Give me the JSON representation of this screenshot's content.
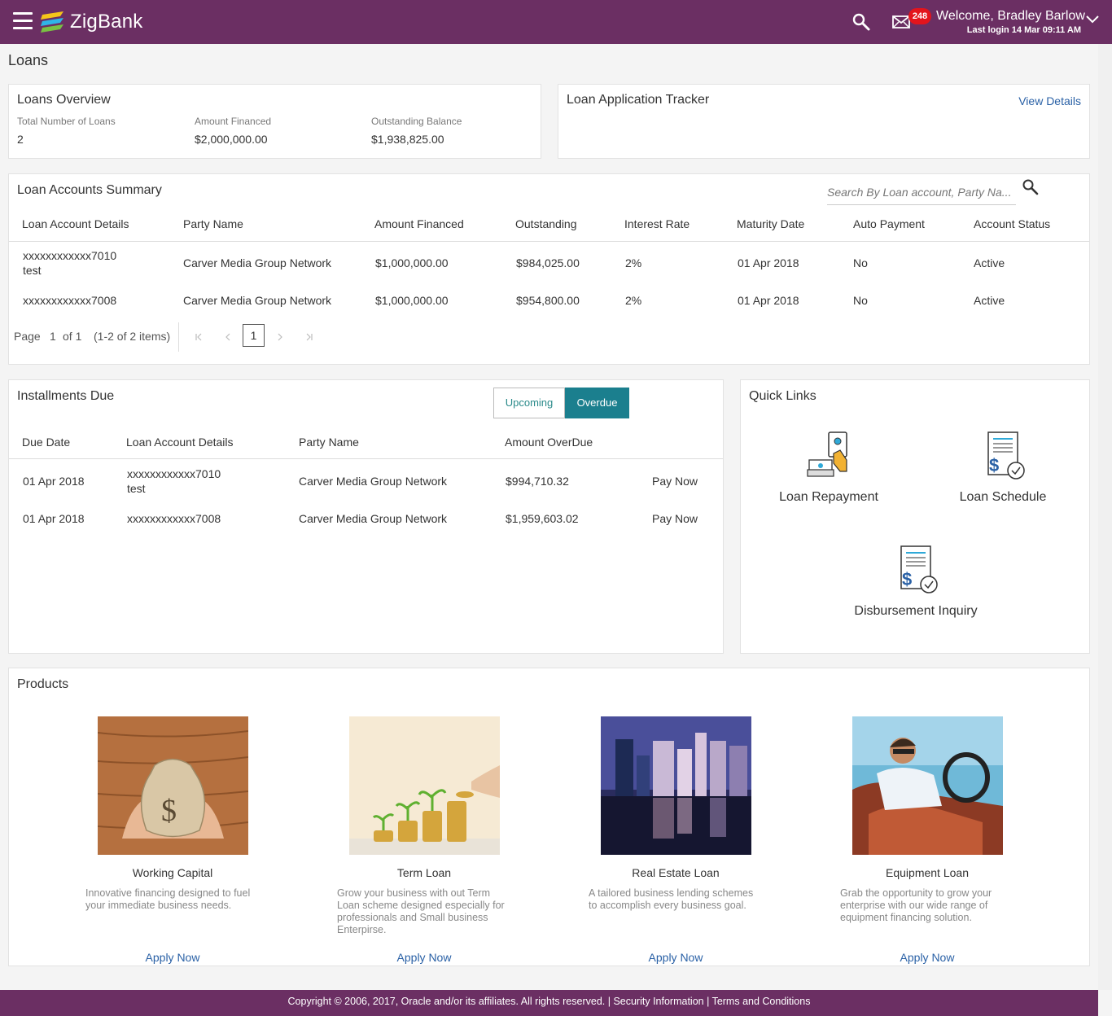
{
  "header": {
    "brand": "ZigBank",
    "notification_count": "248",
    "welcome": "Welcome, Bradley Barlow",
    "last_login": "Last login 14 Mar 09:11 AM"
  },
  "page_title": "Loans",
  "overview": {
    "title": "Loans Overview",
    "items": [
      {
        "label": "Total Number of Loans",
        "value": "2"
      },
      {
        "label": "Amount Financed",
        "value": "$2,000,000.00"
      },
      {
        "label": "Outstanding Balance",
        "value": "$1,938,825.00"
      }
    ]
  },
  "tracker": {
    "title": "Loan Application Tracker",
    "link": "View Details"
  },
  "summary": {
    "title": "Loan Accounts Summary",
    "search_placeholder": "Search By Loan account, Party Na...",
    "columns": [
      "Loan Account Details",
      "Party Name",
      "Amount Financed",
      "Outstanding",
      "Interest Rate",
      "Maturity Date",
      "Auto Payment",
      "Account Status"
    ],
    "rows": [
      {
        "account": "xxxxxxxxxxxx7010",
        "note": "test",
        "party": "Carver Media Group Network",
        "financed": "$1,000,000.00",
        "outstanding": "$984,025.00",
        "rate": "2%",
        "maturity": "01 Apr 2018",
        "auto": "No",
        "status": "Active"
      },
      {
        "account": "xxxxxxxxxxxx7008",
        "note": "",
        "party": "Carver Media Group Network",
        "financed": "$1,000,000.00",
        "outstanding": "$954,800.00",
        "rate": "2%",
        "maturity": "01 Apr 2018",
        "auto": "No",
        "status": "Active"
      }
    ],
    "pager": {
      "page_label": "Page",
      "page": "1",
      "of": "of 1",
      "items": "(1-2 of 2 items)",
      "current": "1"
    }
  },
  "installments": {
    "title": "Installments Due",
    "tabs": [
      "Upcoming",
      "Overdue"
    ],
    "columns": [
      "Due Date",
      "Loan Account Details",
      "Party Name",
      "Amount OverDue"
    ],
    "rows": [
      {
        "due": "01 Apr 2018",
        "account": "xxxxxxxxxxxx7010",
        "note": "test",
        "party": "Carver Media Group Network",
        "amount": "$994,710.32",
        "action": "Pay Now"
      },
      {
        "due": "01 Apr 2018",
        "account": "xxxxxxxxxxxx7008",
        "note": "",
        "party": "Carver Media Group Network",
        "amount": "$1,959,603.02",
        "action": "Pay Now"
      }
    ]
  },
  "quick_links": {
    "title": "Quick Links",
    "items": [
      {
        "label": "Loan Repayment",
        "icon": "loan-repayment-icon"
      },
      {
        "label": "Loan Schedule",
        "icon": "loan-schedule-icon"
      },
      {
        "label": "Disbursement Inquiry",
        "icon": "disbursement-inquiry-icon"
      }
    ]
  },
  "products": {
    "title": "Products",
    "items": [
      {
        "name": "Working Capital",
        "desc": "Innovative financing designed to fuel your immediate business needs.",
        "apply": "Apply Now"
      },
      {
        "name": "Term Loan",
        "desc": "Grow your business with out Term Loan scheme designed especially for professionals and Small business Enterpirse.",
        "apply": "Apply Now"
      },
      {
        "name": "Real Estate Loan",
        "desc": "A tailored business lending schemes to accomplish every business goal.",
        "apply": "Apply Now"
      },
      {
        "name": "Equipment Loan",
        "desc": "Grab the opportunity to grow your enterprise with our wide range of equipment financing solution.",
        "apply": "Apply Now"
      }
    ]
  },
  "footer": {
    "text": "Copyright © 2006, 2017, Oracle and/or its affiliates. All rights reserved. | Security Information | Terms and Conditions"
  },
  "colors": {
    "header": "#6b2f63",
    "accent": "#1b7f8e",
    "link": "#2a61a6"
  }
}
